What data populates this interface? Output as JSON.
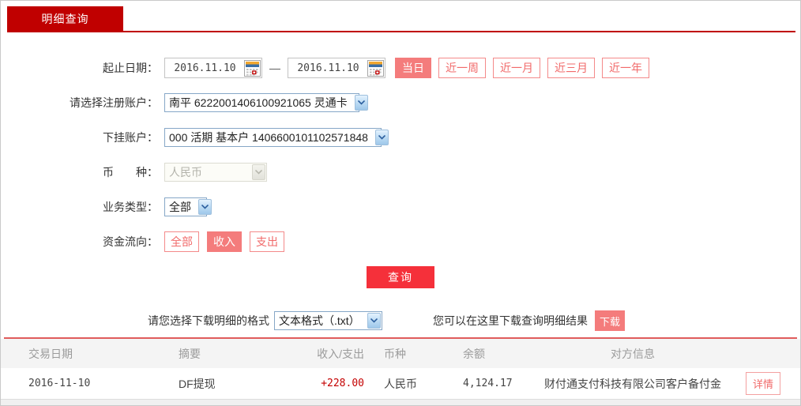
{
  "tab": {
    "label": "明细查询"
  },
  "form": {
    "date_label": "起止日期：",
    "date_from": "2016.11.10",
    "date_to": "2016.11.10",
    "date_separator": "—",
    "quick_buttons": [
      {
        "label": "当日",
        "active": true
      },
      {
        "label": "近一周",
        "active": false
      },
      {
        "label": "近一月",
        "active": false
      },
      {
        "label": "近三月",
        "active": false
      },
      {
        "label": "近一年",
        "active": false
      }
    ],
    "register_account_label": "请选择注册账户：",
    "register_account_value": "南平 6222001406100921065 灵通卡",
    "sub_account_label": "下挂账户：",
    "sub_account_value": "000 活期 基本户 1406600101102571848",
    "currency_label": "币　　种：",
    "currency_value": "人民币",
    "business_type_label": "业务类型：",
    "business_type_value": "全部",
    "fund_flow_label": "资金流向：",
    "fund_flow_buttons": [
      {
        "label": "全部",
        "active": false
      },
      {
        "label": "收入",
        "active": true
      },
      {
        "label": "支出",
        "active": false
      }
    ],
    "query_button_label": "查询",
    "download_format_label": "请您选择下载明细的格式",
    "download_format_value": "文本格式（.txt）",
    "download_hint": "您可以在这里下载查询明细结果",
    "download_button_label": "下载"
  },
  "table": {
    "headers": [
      "交易日期",
      "摘要",
      "收入/支出",
      "币种",
      "余额",
      "对方信息"
    ],
    "rows": [
      {
        "date": "2016-11-10",
        "summary": "DF提现",
        "amount": "+228.00",
        "currency": "人民币",
        "balance": "4,124.17",
        "counterparty": "财付通支付科技有限公司客户备付金",
        "action_label": "详情"
      }
    ]
  },
  "colors": {
    "brand_red": "#c00000",
    "query_red": "#f5303a",
    "salmon": "#f47c7c",
    "amount_red": "#c40000",
    "header_gray": "#f4f4f4"
  }
}
